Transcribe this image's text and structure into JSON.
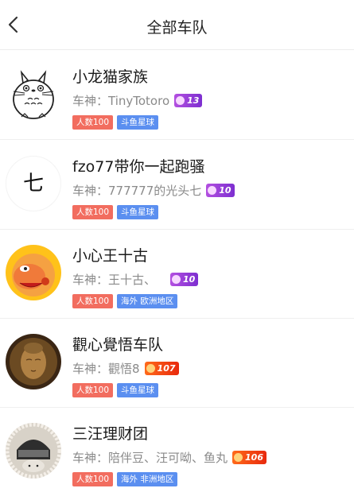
{
  "header": {
    "title": "全部车队"
  },
  "teams": [
    {
      "name": "小龙猫家族",
      "leader": "车神：TinyTotoro",
      "level": "13",
      "level_color": "#9b3fd8",
      "tags": [
        "人数100",
        "斗鱼星球"
      ]
    },
    {
      "name": "fzo77带你一起跑骚",
      "leader": "车神：777777的光头七",
      "level": "10",
      "level_color": "#9b3fd8",
      "tags": [
        "人数100",
        "斗鱼星球"
      ],
      "avatar_text": "七"
    },
    {
      "name": "小心王十古",
      "leader": "车神：王十古、",
      "level": "10",
      "level_color": "#9b3fd8",
      "tags": [
        "人数100",
        "海外 欧洲地区"
      ]
    },
    {
      "name": "觀心覺悟车队",
      "leader": "车神：觀悟8",
      "level": "107",
      "level_color": "#f0450f",
      "tags": [
        "人数100",
        "斗鱼星球"
      ]
    },
    {
      "name": "三汪理财团",
      "leader": "车神：陪伴豆、汪可呦、鱼丸",
      "level": "106",
      "level_color": "#f0450f",
      "tags": [
        "人数100",
        "海外 非洲地区"
      ]
    }
  ]
}
